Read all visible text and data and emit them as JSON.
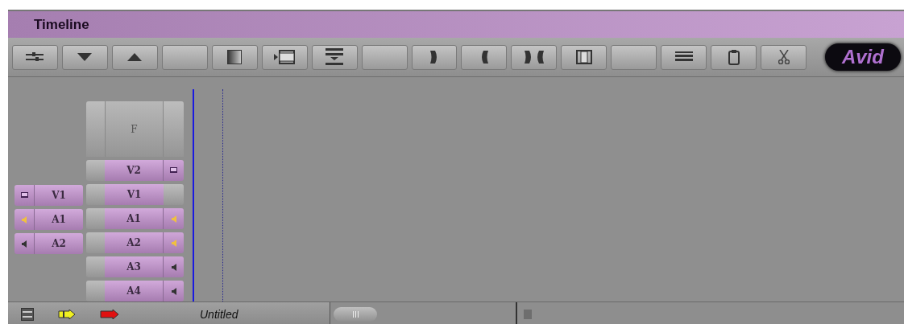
{
  "window": {
    "title": "Timeline"
  },
  "toolbar": {
    "buttons": [
      {
        "kind": "sliders"
      },
      {
        "kind": "down"
      },
      {
        "kind": "up"
      },
      {
        "kind": "blank"
      },
      {
        "kind": "gradient"
      },
      {
        "kind": "play-film"
      },
      {
        "kind": "lift"
      },
      {
        "kind": "blank"
      },
      {
        "kind": "splice-right"
      },
      {
        "kind": "splice-left"
      },
      {
        "kind": "splice-both"
      },
      {
        "kind": "frame"
      },
      {
        "kind": "blank"
      },
      {
        "kind": "rows"
      },
      {
        "kind": "clipboard"
      },
      {
        "kind": "scissors"
      }
    ],
    "logo": "Avid"
  },
  "source_tracks": [
    {
      "label": "V1",
      "kind": "video",
      "monitor": true
    },
    {
      "label": "A1",
      "kind": "audio",
      "monitor": true
    },
    {
      "label": "A2",
      "kind": "audio",
      "monitor": false
    }
  ],
  "record_tracks": {
    "filler": "F",
    "tracks": [
      {
        "label": "V2",
        "kind": "video",
        "monitor": true
      },
      {
        "label": "V1",
        "kind": "video",
        "monitor": false
      },
      {
        "label": "A1",
        "kind": "audio",
        "monitor": true
      },
      {
        "label": "A2",
        "kind": "audio",
        "monitor": true
      },
      {
        "label": "A3",
        "kind": "audio",
        "monitor": false
      },
      {
        "label": "A4",
        "kind": "audio",
        "monitor": false
      }
    ]
  },
  "status_bar": {
    "sequence_name": "Untitled"
  }
}
